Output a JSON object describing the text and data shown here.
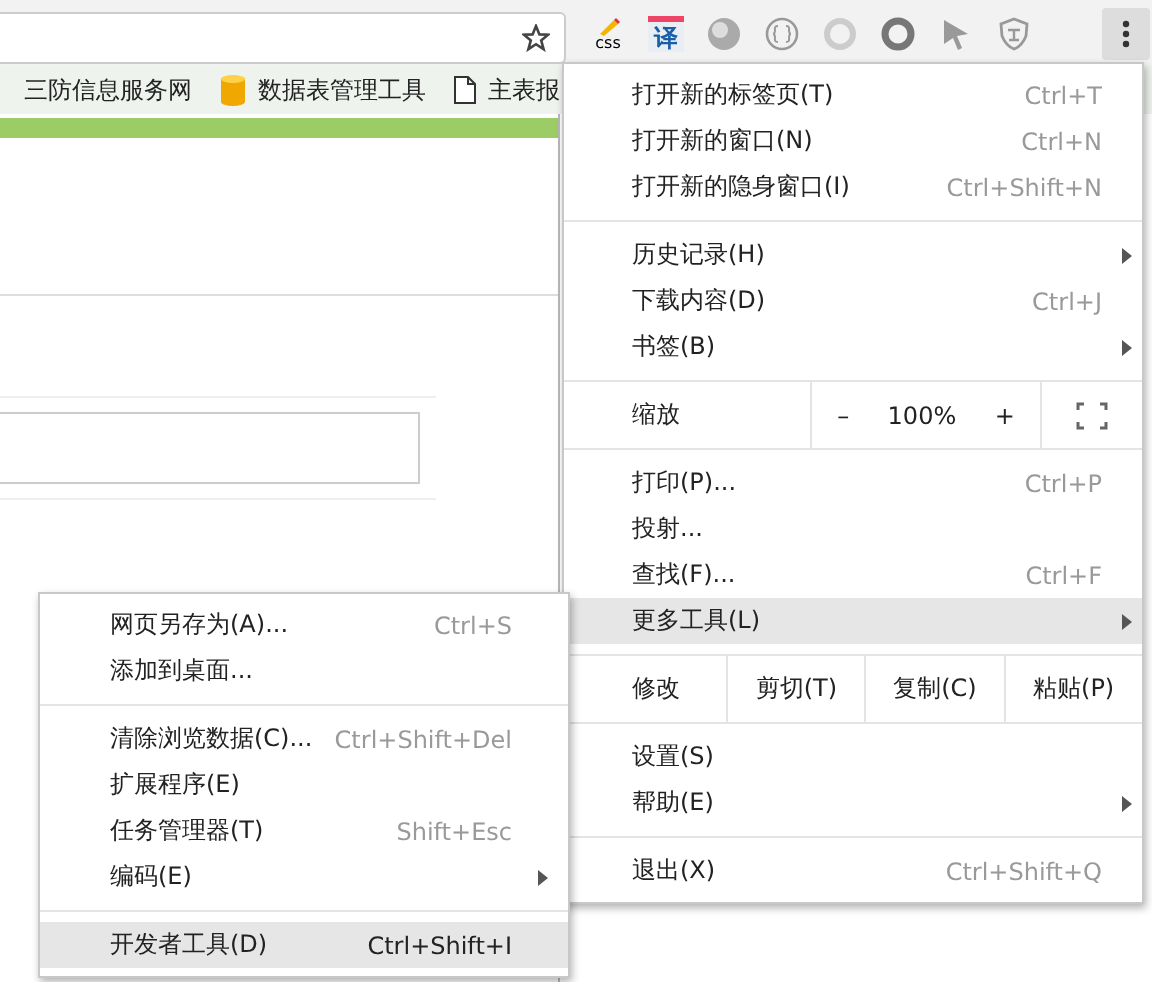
{
  "toolbar": {
    "extensions": [
      {
        "kind": "css",
        "text": "css"
      },
      {
        "kind": "translate",
        "text": "译"
      },
      {
        "kind": "globe"
      },
      {
        "kind": "braces"
      },
      {
        "kind": "ring-faint"
      },
      {
        "kind": "ring"
      },
      {
        "kind": "cursor"
      },
      {
        "kind": "shield"
      }
    ]
  },
  "bookmarks": [
    {
      "kind": "text",
      "label": "三防信息服务网"
    },
    {
      "kind": "database",
      "label": "数据表管理工具"
    },
    {
      "kind": "page",
      "label": "主表报"
    }
  ],
  "menu": {
    "sections": [
      [
        {
          "kind": "item",
          "label": "打开新的标签页(T)",
          "shortcut": "Ctrl+T",
          "submenu": false,
          "selected": false
        },
        {
          "kind": "item",
          "label": "打开新的窗口(N)",
          "shortcut": "Ctrl+N",
          "submenu": false,
          "selected": false
        },
        {
          "kind": "item",
          "label": "打开新的隐身窗口(I)",
          "shortcut": "Ctrl+Shift+N",
          "submenu": false,
          "selected": false
        }
      ],
      [
        {
          "kind": "item",
          "label": "历史记录(H)",
          "submenu": true,
          "selected": false
        },
        {
          "kind": "item",
          "label": "下载内容(D)",
          "shortcut": "Ctrl+J",
          "submenu": false,
          "selected": false
        },
        {
          "kind": "item",
          "label": "书签(B)",
          "submenu": true,
          "selected": false
        }
      ],
      [
        {
          "kind": "zoom",
          "label": "缩放",
          "minus": "–",
          "value": "100%",
          "plus": "+"
        }
      ],
      [
        {
          "kind": "item",
          "label": "打印(P)...",
          "shortcut": "Ctrl+P",
          "submenu": false,
          "selected": false
        },
        {
          "kind": "item",
          "label": "投射...",
          "submenu": false,
          "selected": false
        },
        {
          "kind": "item",
          "label": "查找(F)...",
          "shortcut": "Ctrl+F",
          "submenu": false,
          "selected": false
        },
        {
          "kind": "item",
          "label": "更多工具(L)",
          "submenu": true,
          "selected": true
        }
      ],
      [
        {
          "kind": "edit",
          "label": "修改",
          "buttons": [
            "剪切(T)",
            "复制(C)",
            "粘贴(P)"
          ]
        }
      ],
      [
        {
          "kind": "item",
          "label": "设置(S)",
          "submenu": false,
          "selected": false
        },
        {
          "kind": "item",
          "label": "帮助(E)",
          "submenu": true,
          "selected": false
        }
      ],
      [
        {
          "kind": "item",
          "label": "退出(X)",
          "shortcut": "Ctrl+Shift+Q",
          "submenu": false,
          "selected": false
        }
      ]
    ]
  },
  "submenu": {
    "sections": [
      [
        {
          "label": "网页另存为(A)...",
          "shortcut": "Ctrl+S",
          "submenu": false,
          "selected": false
        },
        {
          "label": "添加到桌面...",
          "submenu": false,
          "selected": false
        }
      ],
      [
        {
          "label": "清除浏览数据(C)...",
          "shortcut": "Ctrl+Shift+Del",
          "submenu": false,
          "selected": false
        },
        {
          "label": "扩展程序(E)",
          "submenu": false,
          "selected": false
        },
        {
          "label": "任务管理器(T)",
          "shortcut": "Shift+Esc",
          "submenu": false,
          "selected": false
        },
        {
          "label": "编码(E)",
          "submenu": true,
          "selected": false
        }
      ],
      [
        {
          "label": "开发者工具(D)",
          "shortcut": "Ctrl+Shift+I",
          "submenu": false,
          "selected": true
        }
      ]
    ]
  }
}
